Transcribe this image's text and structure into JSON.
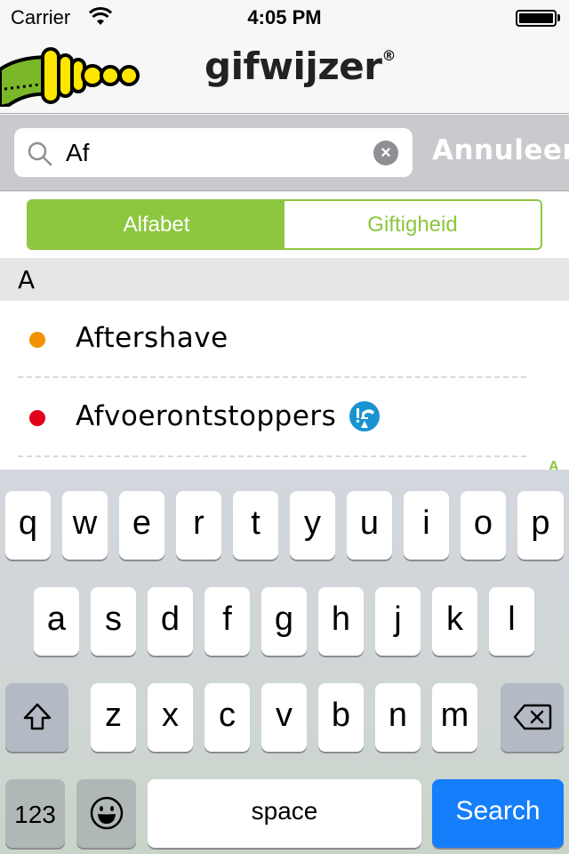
{
  "status_bar": {
    "carrier": "Carrier",
    "time": "4:05 PM",
    "battery_level_percent": 100
  },
  "header": {
    "brand": "gifwijzer",
    "registered_mark": "®"
  },
  "search": {
    "query": "Af",
    "placeholder": "",
    "clear_icon": "×",
    "cancel_label": "Annuleer"
  },
  "segmented": {
    "options": [
      "Alfabet",
      "Giftigheid"
    ],
    "selected": "Alfabet",
    "accent_color": "#8dc63f"
  },
  "list": {
    "section_header": "A",
    "items": [
      {
        "name": "Aftershave",
        "toxicity_color": "#f39200",
        "badge": null
      },
      {
        "name": "Afvoerontstoppers",
        "toxicity_color": "#e2001a",
        "badge": "hazard-warning-icon"
      }
    ],
    "index_letter": "A"
  },
  "keyboard": {
    "row1": [
      "q",
      "w",
      "e",
      "r",
      "t",
      "y",
      "u",
      "i",
      "o",
      "p"
    ],
    "row2": [
      "a",
      "s",
      "d",
      "f",
      "g",
      "h",
      "j",
      "k",
      "l"
    ],
    "row3": [
      "z",
      "x",
      "c",
      "v",
      "b",
      "n",
      "m"
    ],
    "numbers_label": "123",
    "space_label": "space",
    "search_label": "Search",
    "search_color": "#147efb"
  }
}
